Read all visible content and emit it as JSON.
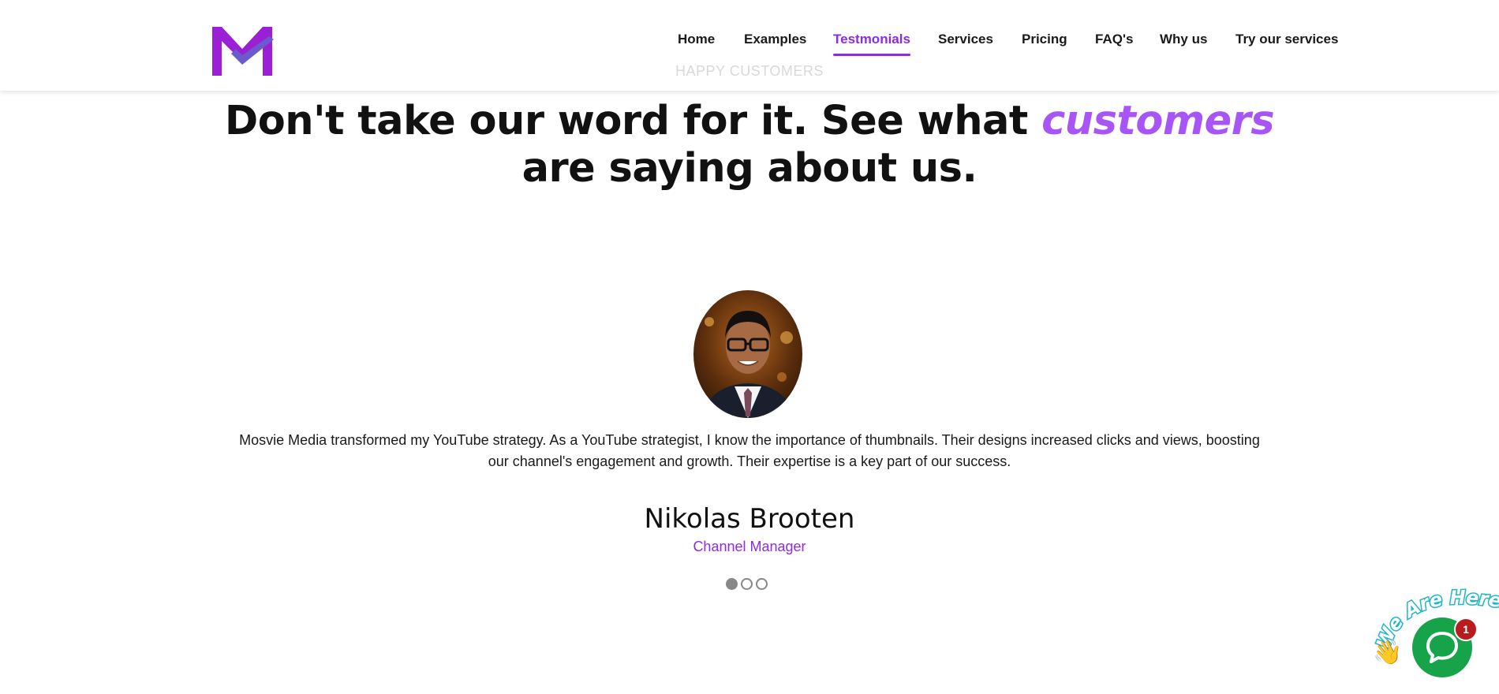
{
  "header": {
    "logo_alt": "M",
    "nav": [
      {
        "label": "Home"
      },
      {
        "label": "Examples"
      },
      {
        "label": "Testmonials"
      },
      {
        "label": "Services"
      },
      {
        "label": "Pricing"
      },
      {
        "label": "FAQ's"
      },
      {
        "label": "Why us"
      },
      {
        "label": "Try our services"
      }
    ],
    "active_index": 2
  },
  "section": {
    "eyebrow": "HAPPY CUSTOMERS",
    "headline_part1": "Don't take our word for it. See what ",
    "headline_accent": "customers",
    "headline_part2": " are saying about us."
  },
  "testimonial": {
    "quote": "Mosvie Media transformed my YouTube strategy. As a YouTube strategist, I know the importance of thumbnails. Their designs increased clicks and views, boosting our channel's engagement and growth. Their expertise is a key part of our success.",
    "name": "Nikolas Brooten",
    "role": "Channel Manager",
    "slides_total": 3,
    "active_slide": 1
  },
  "chat": {
    "label": "We Are Here!",
    "badge_count": "1",
    "icon": "chat-icon"
  },
  "colors": {
    "accent": "#8b2be2",
    "headline_accent": "#a855f7",
    "chat_green": "#16a34a",
    "badge_red": "#b91c1c"
  }
}
